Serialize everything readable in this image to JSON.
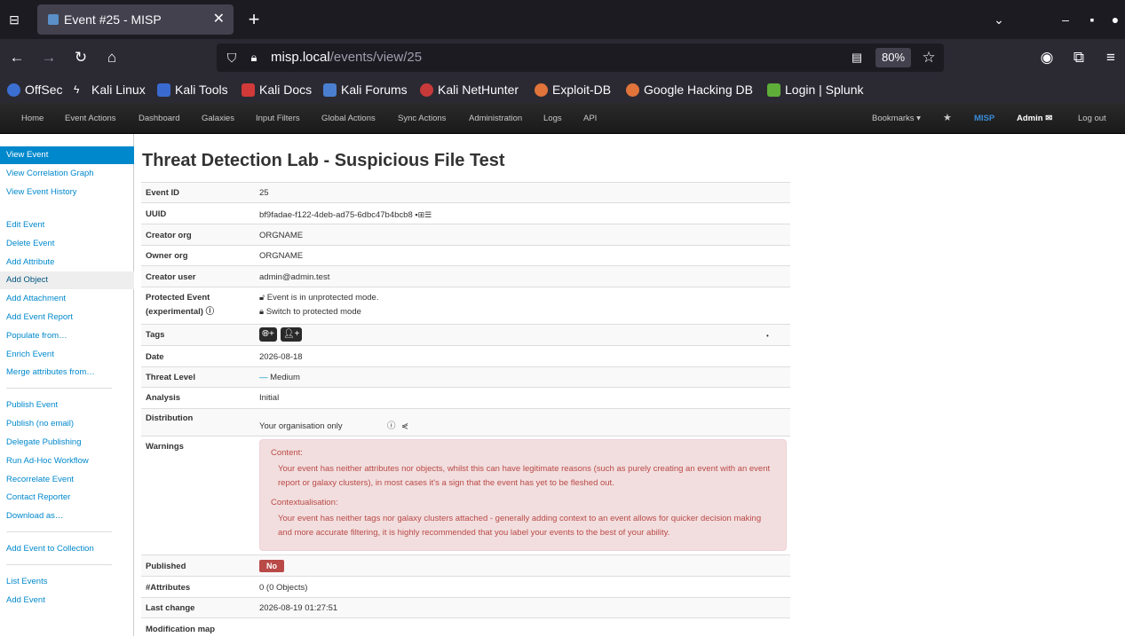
{
  "browser": {
    "tab_title": "Event #25 - MISP",
    "url_host": "misp.local",
    "url_path": "/events/view/25",
    "zoom": "80%",
    "bookmarks": [
      "OffSec",
      "Kali Linux",
      "Kali Tools",
      "Kali Docs",
      "Kali Forums",
      "Kali NetHunter",
      "Exploit-DB",
      "Google Hacking DB",
      "Login | Splunk"
    ]
  },
  "topnav": {
    "items": [
      "Home",
      "Event Actions",
      "Dashboard",
      "Galaxies",
      "Input Filters",
      "Global Actions",
      "Sync Actions",
      "Administration",
      "Logs",
      "API"
    ],
    "bookmarks": "Bookmarks",
    "misp": "MISP",
    "admin": "Admin",
    "logout": "Log out"
  },
  "sidebar": {
    "items": [
      "View Event",
      "View Correlation Graph",
      "View Event History",
      "Edit Event",
      "Delete Event",
      "Add Attribute",
      "Add Object",
      "Add Attachment",
      "Add Event Report",
      "Populate from…",
      "Enrich Event",
      "Merge attributes from…",
      "Publish Event",
      "Publish (no email)",
      "Delegate Publishing",
      "Run Ad-Hoc Workflow",
      "Recorrelate Event",
      "Contact Reporter",
      "Download as…",
      "Add Event to Collection",
      "List Events",
      "Add Event"
    ]
  },
  "event": {
    "title": "Threat Detection Lab - Suspicious File Test",
    "labels": {
      "event_id": "Event ID",
      "uuid": "UUID",
      "creator_org": "Creator org",
      "owner_org": "Owner org",
      "creator_user": "Creator user",
      "protected_1": "Protected Event",
      "protected_2": "(experimental)",
      "tags": "Tags",
      "date": "Date",
      "threat_level": "Threat Level",
      "analysis": "Analysis",
      "distribution": "Distribution",
      "warnings": "Warnings",
      "published": "Published",
      "attributes": "#Attributes",
      "last_change": "Last change",
      "modification_map": "Modification map"
    },
    "values": {
      "event_id": "25",
      "uuid": "bf9fadae-f122-4deb-ad75-6dbc47b4bcb8",
      "creator_org": "ORGNAME",
      "owner_org": "ORGNAME",
      "creator_user": "admin@admin.test",
      "protected_state": "Event is in unprotected mode.",
      "protected_link": "Switch to protected mode",
      "date": "2026-08-18",
      "threat_level": "Medium",
      "analysis": "Initial",
      "distribution": "Your organisation only",
      "published": "No",
      "attributes": "0 (0 Objects)",
      "last_change": "2026-08-19 01:27:51"
    },
    "warnings": {
      "content_head": "Content:",
      "content_text": "Your event has neither attributes nor objects, whilst this can have legitimate reasons (such as purely creating an event with an event report or galaxy clusters), in most cases it's a sign that the event has yet to be fleshed out.",
      "context_head": "Contextualisation:",
      "context_text": "Your event has neither tags nor galaxy clusters attached - generally adding context to an event allows for quicker decision making and more accurate filtering, it is highly recommended that you label your events to the best of your ability."
    }
  },
  "colors": {
    "misp_blue": "#0088cc",
    "danger": "#b94a48",
    "warn_bg": "#f2dede"
  }
}
